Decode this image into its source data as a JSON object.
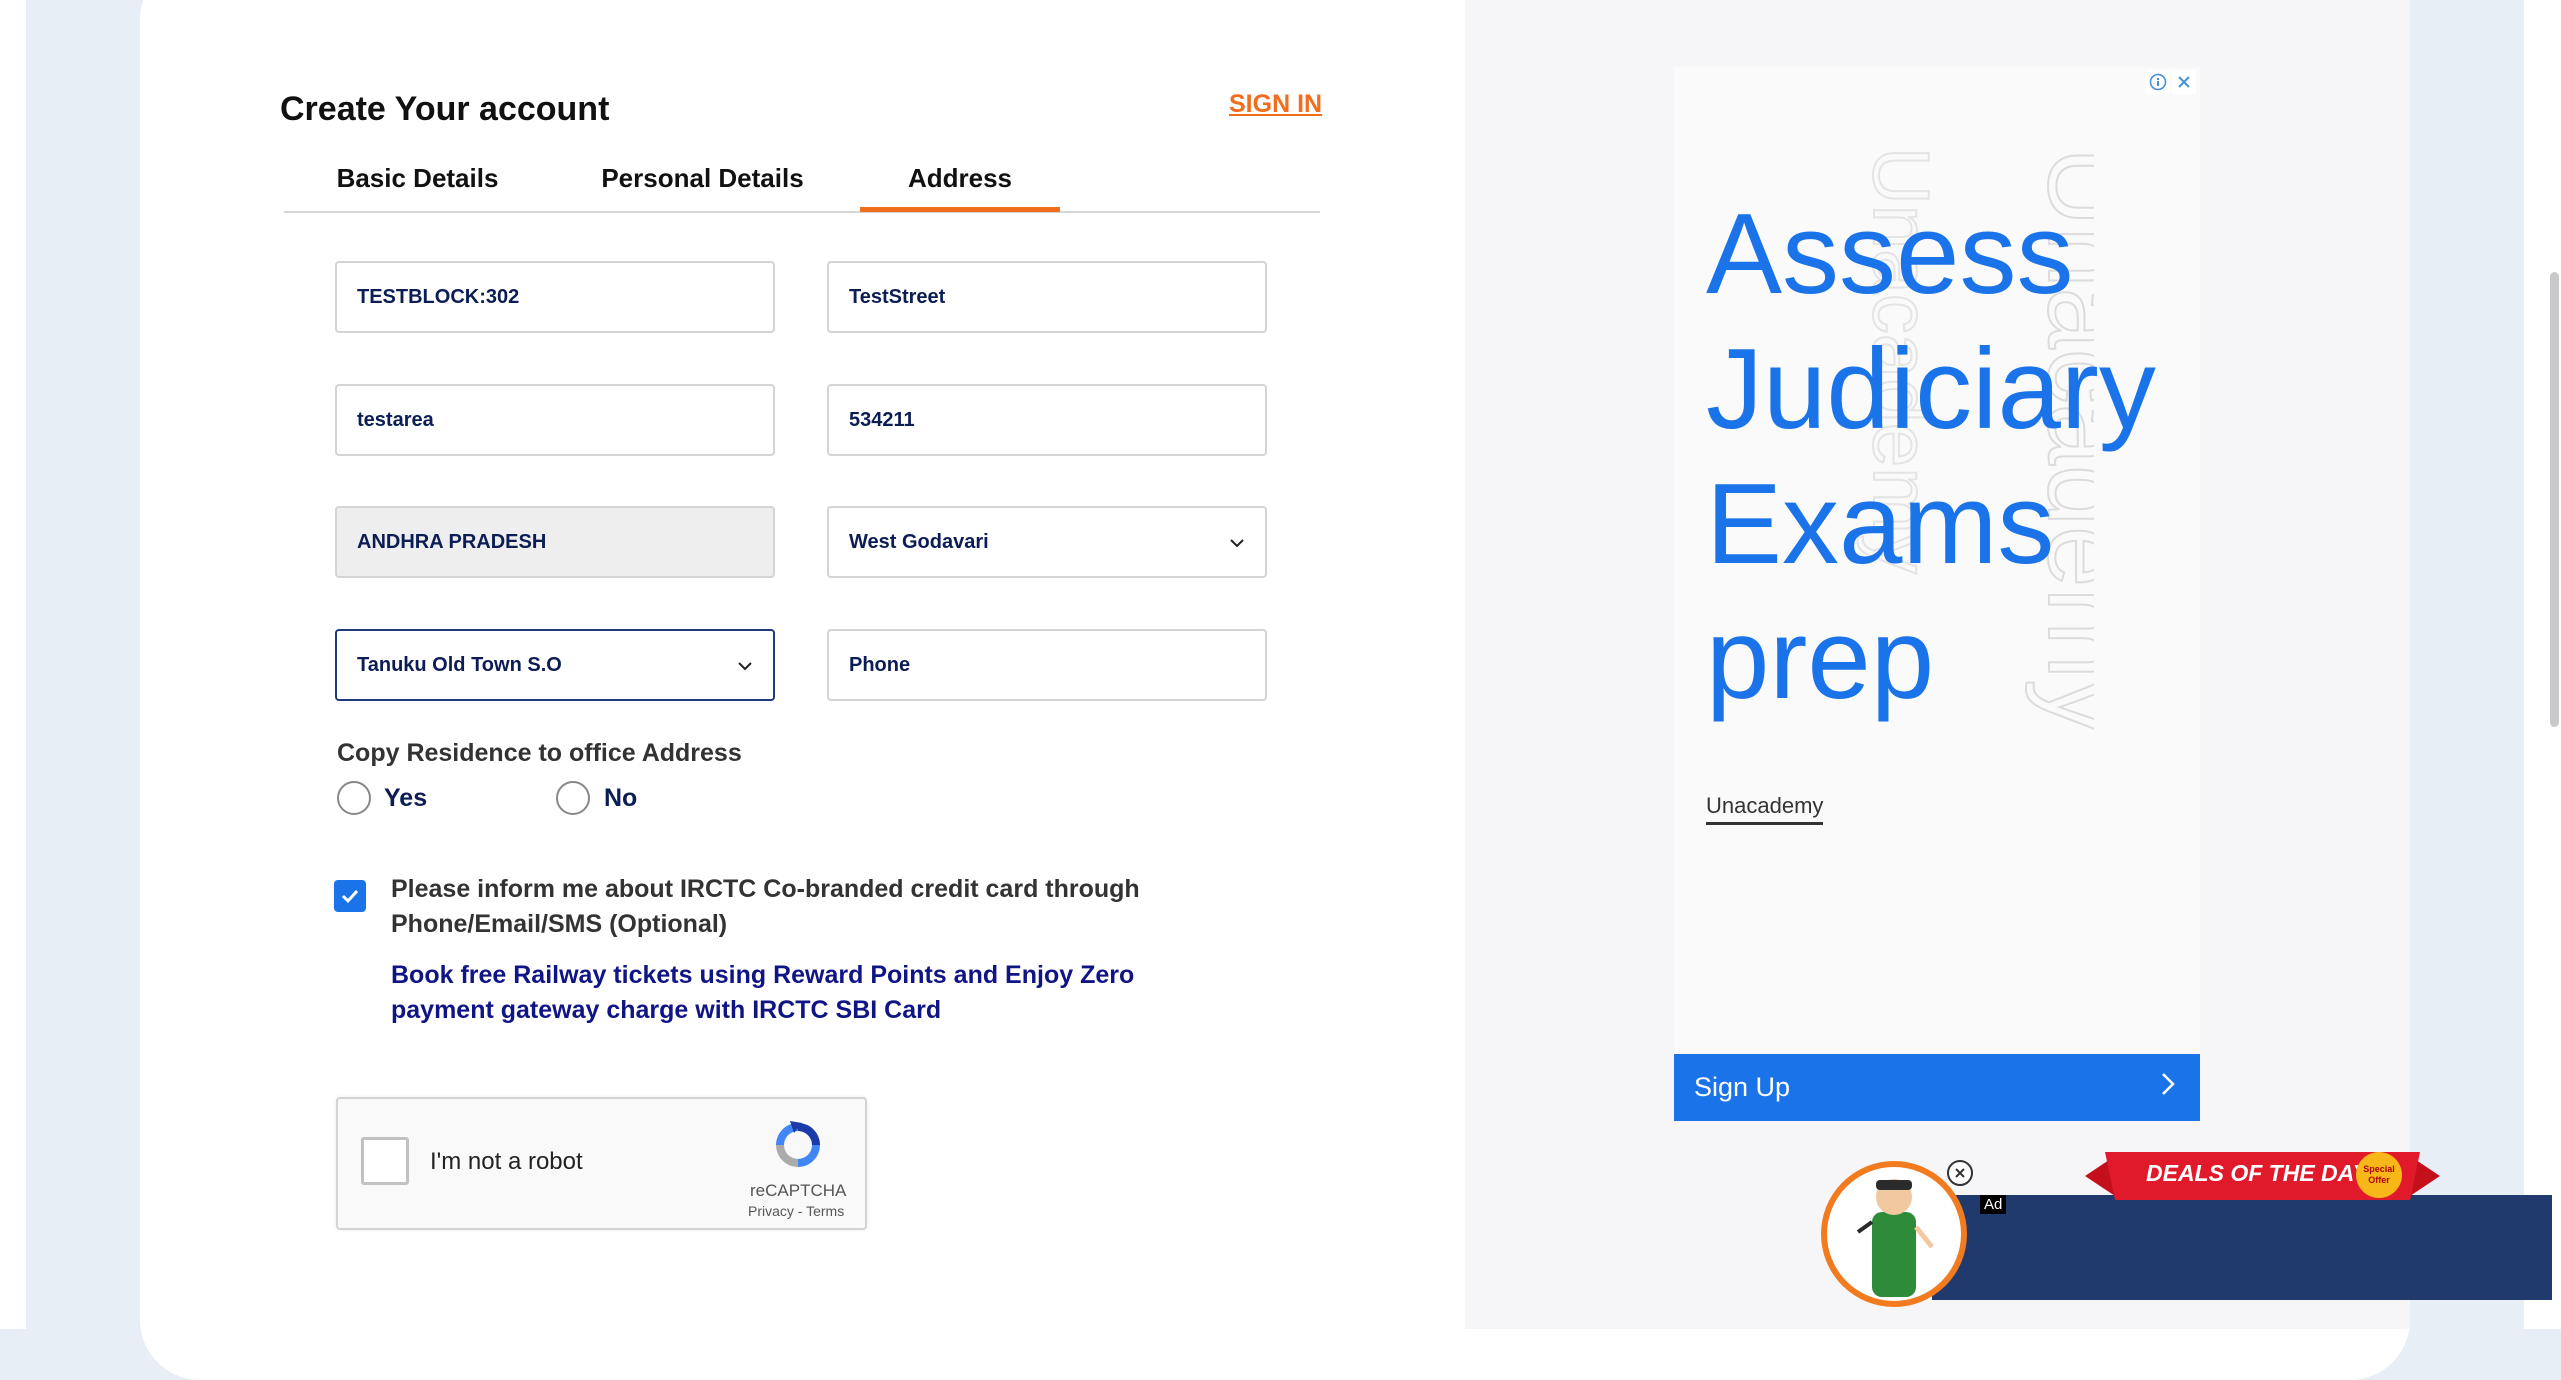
{
  "header": {
    "title": "Create Your account",
    "signin_label": "SIGN IN"
  },
  "tabs": [
    {
      "label": "Basic Details",
      "active": false
    },
    {
      "label": "Personal Details",
      "active": false
    },
    {
      "label": "Address",
      "active": true
    }
  ],
  "address": {
    "address_line": "TESTBLOCK:302",
    "street": "TestStreet",
    "area": "testarea",
    "pincode": "534211",
    "state": "ANDHRA PRADESH",
    "district": "West Godavari",
    "post_office": "Tanuku Old Town S.O",
    "phone_placeholder": "Phone"
  },
  "copy_address": {
    "label": "Copy Residence to office Address",
    "yes_label": "Yes",
    "no_label": "No"
  },
  "consent": {
    "checked": true,
    "text": "Please inform me about IRCTC Co-branded credit card through Phone/Email/SMS (Optional)",
    "promo": "Book free Railway tickets using Reward Points and Enjoy Zero payment gateway charge with IRCTC SBI Card"
  },
  "recaptcha": {
    "label": "I'm not a robot",
    "brand": "reCAPTCHA",
    "links": "Privacy - Terms"
  },
  "advertisement": {
    "headline": "Assess Judiciary Exams prep",
    "watermark": "Unacademy",
    "brand": "Unacademy",
    "cta": "Sign Up"
  },
  "deals_banner": {
    "title": "DEALS OF THE DAY",
    "badge": "Special Offer",
    "ad_tag": "Ad"
  },
  "colors": {
    "accent": "#f26e1f",
    "link_blue": "#1a73e8",
    "navy": "#0b1d54",
    "deals_bar": "#213a6e"
  }
}
